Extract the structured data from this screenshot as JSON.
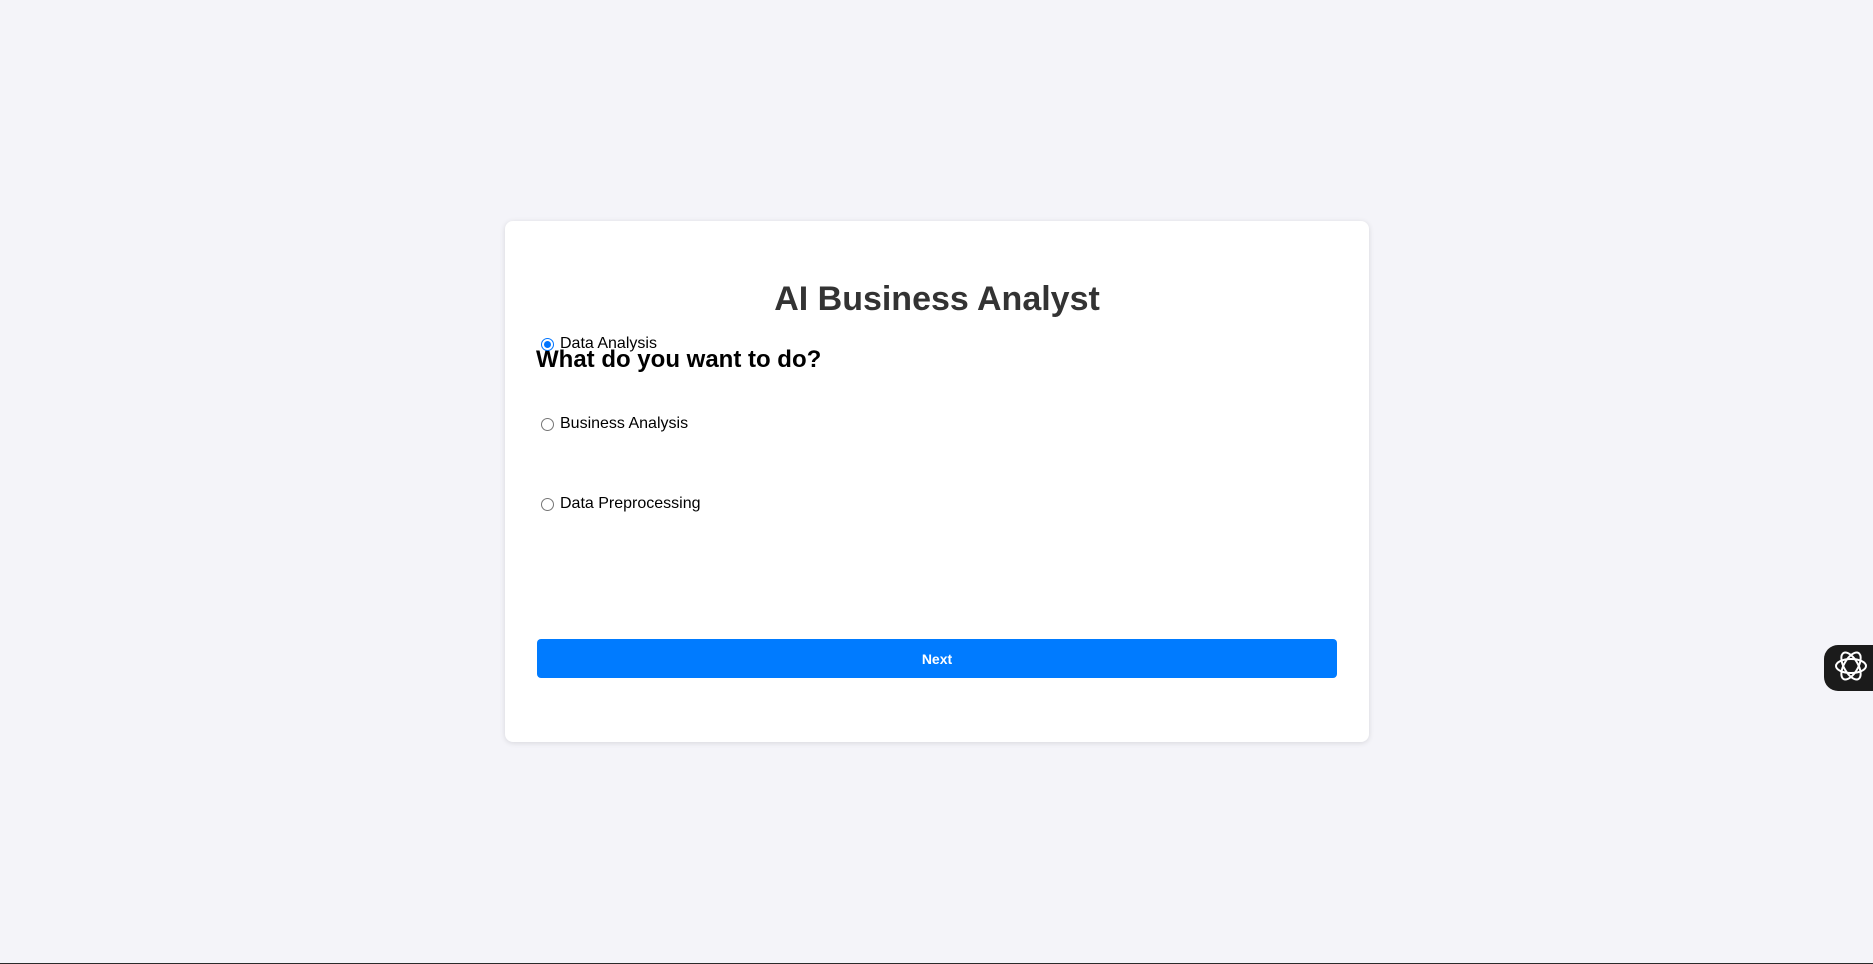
{
  "app": {
    "title": "AI Business Analyst"
  },
  "form": {
    "question": "What do you want to do?",
    "options": [
      {
        "label": "Data Analysis",
        "checked": true
      },
      {
        "label": "Business Analysis",
        "checked": false
      },
      {
        "label": "Data Preprocessing",
        "checked": false
      }
    ],
    "next_label": "Next"
  },
  "colors": {
    "page_background": "#f4f4f9",
    "card_background": "#ffffff",
    "accent": "#007bff",
    "radio_checked": "#0075ff",
    "title_text": "#333333"
  },
  "widget": {
    "icon": "openai-logo-icon"
  }
}
